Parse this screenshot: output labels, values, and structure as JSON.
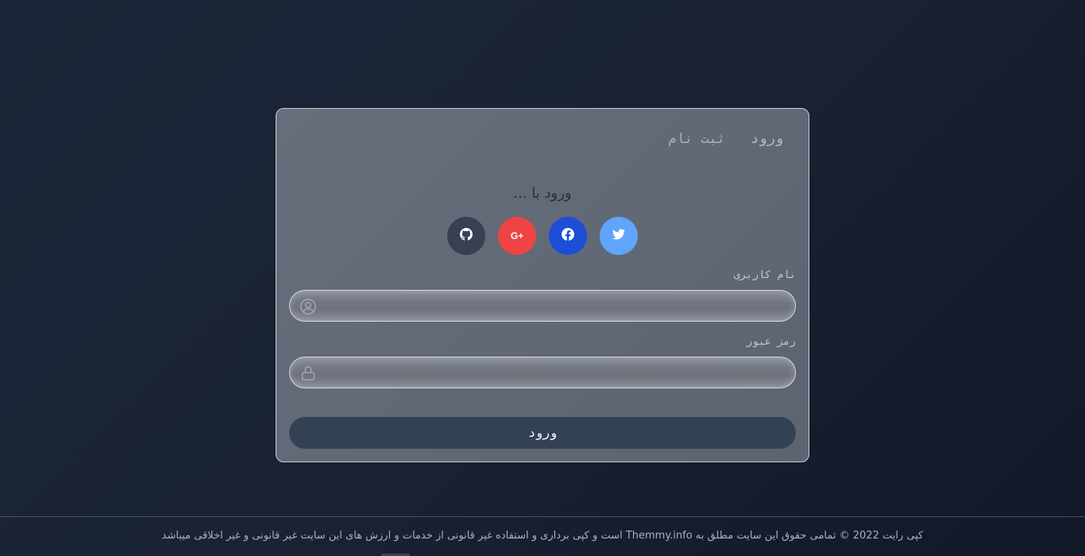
{
  "tabs": {
    "login": "ورود",
    "register": "ثبت نام"
  },
  "social": {
    "heading": "ورود با ...",
    "buttons": [
      {
        "name": "twitter",
        "icon": "twitter-icon",
        "color": "#60a5fa"
      },
      {
        "name": "facebook",
        "icon": "facebook-icon",
        "color": "#1d4ed8"
      },
      {
        "name": "google",
        "icon": "google-plus-icon",
        "label": "G+",
        "color": "#ef4444"
      },
      {
        "name": "github",
        "icon": "github-icon",
        "color": "#374151"
      }
    ]
  },
  "form": {
    "username_label": "نام کاربری",
    "username_value": "",
    "password_label": "رمز عبور",
    "password_value": "",
    "submit_label": "ورود"
  },
  "footer": {
    "text": "کپی رایت 2022 © تمامی حقوق این سایت مطلق به Themmy.info است و کپی برداری و استفاده غیر قانونی از خدمات و ارزش های این سایت غیر قانونی و غیر اخلاقی میباشد"
  },
  "colors": {
    "submit": "#334155",
    "card": "#636a77"
  }
}
